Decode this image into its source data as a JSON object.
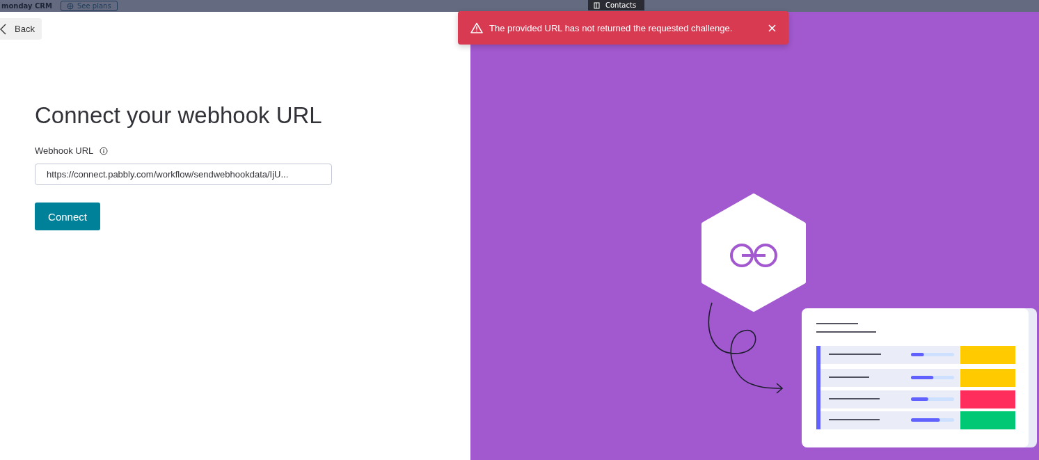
{
  "top_bar": {
    "brand": "monday CRM",
    "plans_button": "See plans",
    "board_tab": "Contacts"
  },
  "back_button": {
    "label": "Back"
  },
  "title": "Connect your webhook URL",
  "webhook_field": {
    "label": "Webhook URL",
    "value": "https://connect.pabbly.com/workflow/sendwebhookdata/IjU..."
  },
  "connect_button": {
    "label": "Connect"
  },
  "toast": {
    "message": "The provided URL has not returned the requested challenge.",
    "kind": "error"
  }
}
